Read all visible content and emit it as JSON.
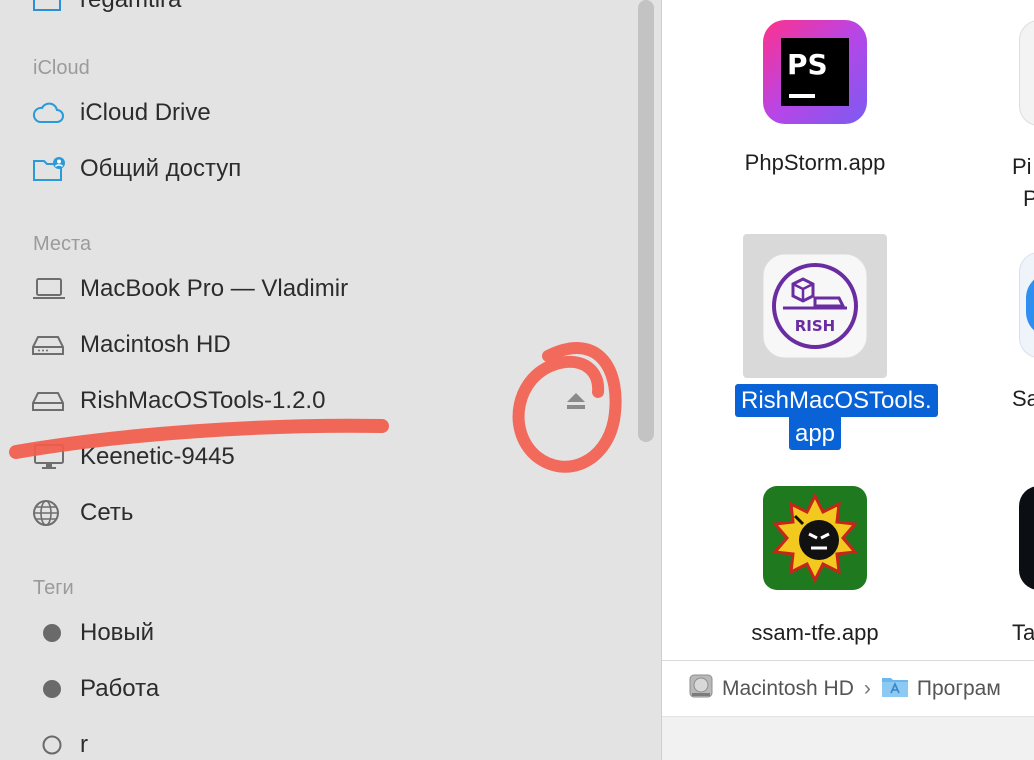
{
  "sidebar": {
    "top_partial_item": "regamtira",
    "icloud_section": {
      "title": "iCloud",
      "items": [
        {
          "label": "iCloud Drive",
          "icon": "cloud-icon"
        },
        {
          "label": "Общий доступ",
          "icon": "shared-folder-icon"
        }
      ]
    },
    "places_section": {
      "title": "Места",
      "items": [
        {
          "label": "MacBook Pro — Vladimir",
          "icon": "laptop-icon"
        },
        {
          "label": "Macintosh HD",
          "icon": "internal-drive-icon"
        },
        {
          "label": "RishMacOSTools-1.2.0",
          "icon": "external-drive-icon",
          "eject": true
        },
        {
          "label": "Keenetic-9445",
          "icon": "display-icon"
        },
        {
          "label": "Сеть",
          "icon": "globe-icon"
        }
      ]
    },
    "tags_section": {
      "title": "Теги",
      "items": [
        {
          "label": "Новый",
          "icon": "tag-dot-filled-icon"
        },
        {
          "label": "Работа",
          "icon": "tag-dot-filled-icon"
        },
        {
          "label": "r",
          "icon": "tag-dot-empty-icon"
        }
      ]
    }
  },
  "apps": {
    "phpstorm": {
      "label": "PhpStorm.app",
      "icon_text": "PS"
    },
    "rish": {
      "label_line1": "RishMacOSTools.",
      "label_line2": "app",
      "icon_text": "RISH"
    },
    "ssam": {
      "label": "ssam-tfe.app"
    },
    "partial_right": [
      "Pi",
      "P",
      "Sa",
      "Ta"
    ]
  },
  "pathbar": {
    "items": [
      "Macintosh HD",
      "Програм"
    ],
    "separator": "›"
  },
  "colors": {
    "selection": "#0a63d6",
    "annotation": "#f25c4b",
    "sidebar_bg": "#e3e3e3"
  }
}
